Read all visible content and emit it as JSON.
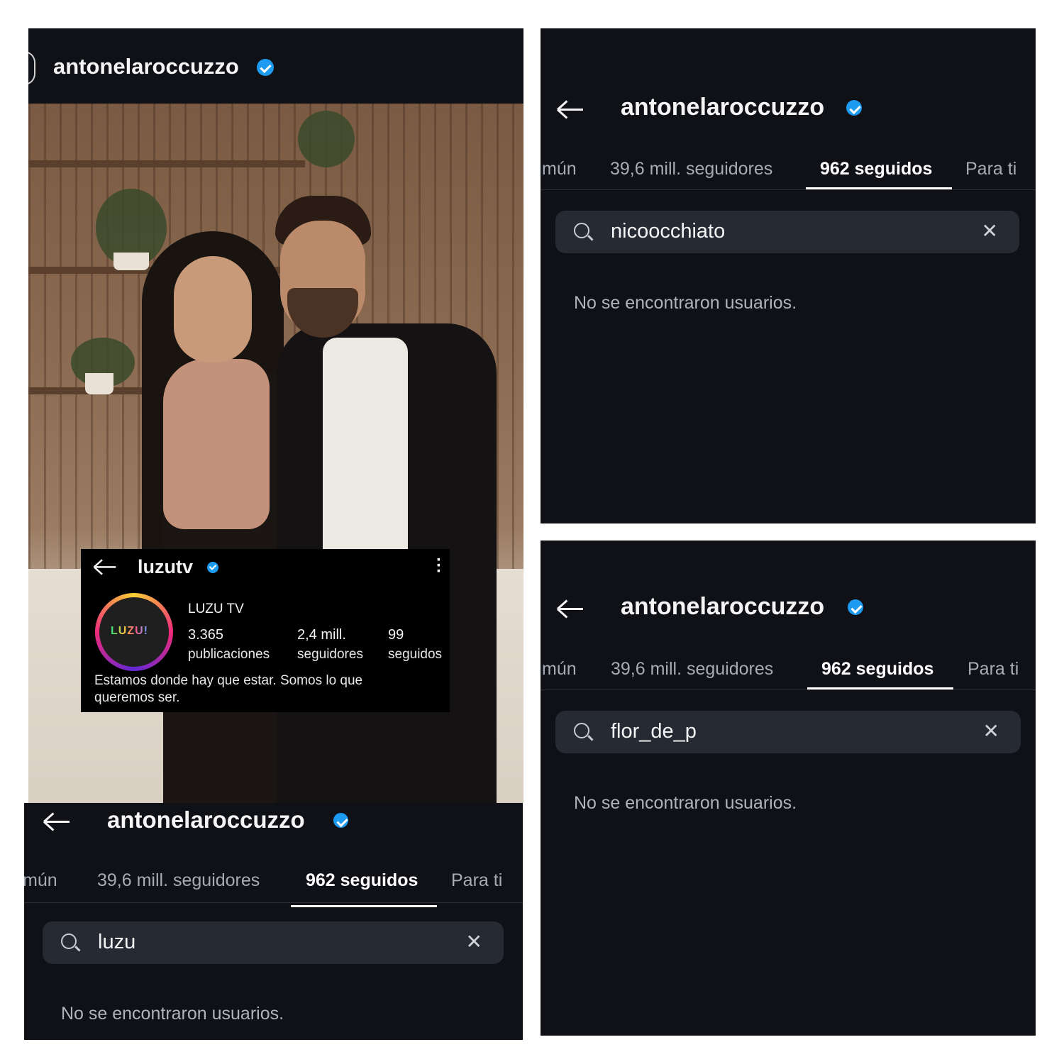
{
  "left_panel": {
    "username": "antonelaroccuzzo",
    "luzu": {
      "username": "luzutv",
      "display_name": "LUZU TV",
      "logo_text": "LUZU!",
      "posts_count": "3.365",
      "posts_label": "publicaciones",
      "followers_count": "2,4 mill.",
      "followers_label": "seguidores",
      "following_count": "99",
      "following_label": "seguidos",
      "bio": "Estamos donde hay que estar. Somos lo que queremos ser."
    }
  },
  "panels": [
    {
      "username": "antonelaroccuzzo",
      "tabs": [
        "mún",
        "39,6 mill. seguidores",
        "962 seguidos",
        "Para ti"
      ],
      "active_tab": 2,
      "search_query": "nicoocchiato",
      "empty_message": "No se encontraron usuarios."
    },
    {
      "username": "antonelaroccuzzo",
      "tabs": [
        "mún",
        "39,6 mill. seguidores",
        "962 seguidos",
        "Para ti"
      ],
      "active_tab": 2,
      "search_query": "flor_de_p",
      "empty_message": "No se encontraron usuarios."
    },
    {
      "username": "antonelaroccuzzo",
      "tabs": [
        "mún",
        "39,6 mill. seguidores",
        "962 seguidos",
        "Para ti"
      ],
      "active_tab": 2,
      "search_query": "luzu",
      "empty_message": "No se encontraron usuarios."
    }
  ],
  "icons": {
    "verified": "verified-badge-icon",
    "back": "back-arrow-icon",
    "search": "search-icon",
    "clear": "clear-icon",
    "more": "more-options-icon"
  },
  "colors": {
    "background": "#0f1117",
    "verified": "#1d9bf0",
    "search_field": "#262a33"
  }
}
